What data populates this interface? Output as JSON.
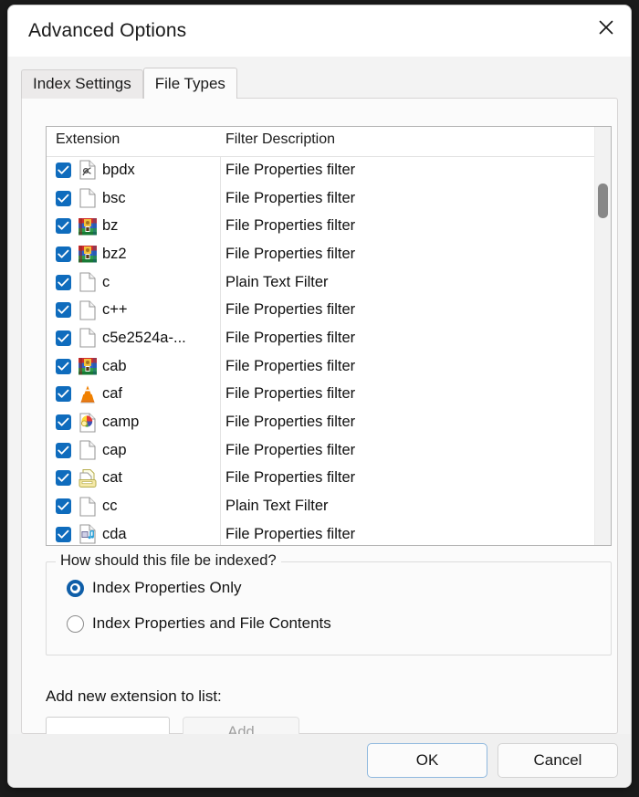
{
  "window": {
    "title": "Advanced Options",
    "close_icon": "close-icon"
  },
  "tabs": [
    {
      "label": "Index Settings",
      "active": false
    },
    {
      "label": "File Types",
      "active": true
    }
  ],
  "file_types_list": {
    "columns": {
      "extension": "Extension",
      "description": "Filter Description"
    },
    "rows": [
      {
        "checked": true,
        "icon": "pdf-file-icon",
        "ext": "bpdx",
        "desc": "File Properties filter"
      },
      {
        "checked": true,
        "icon": "blank-file-icon",
        "ext": "bsc",
        "desc": "File Properties filter"
      },
      {
        "checked": true,
        "icon": "archive-icon",
        "ext": "bz",
        "desc": "File Properties filter"
      },
      {
        "checked": true,
        "icon": "archive-icon",
        "ext": "bz2",
        "desc": "File Properties filter"
      },
      {
        "checked": true,
        "icon": "blank-file-icon",
        "ext": "c",
        "desc": "Plain Text Filter"
      },
      {
        "checked": true,
        "icon": "blank-file-icon",
        "ext": "c++",
        "desc": "File Properties filter"
      },
      {
        "checked": true,
        "icon": "blank-file-icon",
        "ext": "c5e2524a-...",
        "desc": "File Properties filter"
      },
      {
        "checked": true,
        "icon": "archive-icon",
        "ext": "cab",
        "desc": "File Properties filter"
      },
      {
        "checked": true,
        "icon": "vlc-cone-icon",
        "ext": "caf",
        "desc": "File Properties filter"
      },
      {
        "checked": true,
        "icon": "camtasia-icon",
        "ext": "camp",
        "desc": "File Properties filter"
      },
      {
        "checked": true,
        "icon": "blank-file-icon",
        "ext": "cap",
        "desc": "File Properties filter"
      },
      {
        "checked": true,
        "icon": "catalog-icon",
        "ext": "cat",
        "desc": "File Properties filter"
      },
      {
        "checked": true,
        "icon": "blank-file-icon",
        "ext": "cc",
        "desc": "Plain Text Filter"
      },
      {
        "checked": true,
        "icon": "media-file-icon",
        "ext": "cda",
        "desc": "File Properties filter"
      }
    ]
  },
  "index_group": {
    "legend": "How should this file be indexed?",
    "options": [
      {
        "label": "Index Properties Only",
        "selected": true
      },
      {
        "label": "Index Properties and File Contents",
        "selected": false
      }
    ]
  },
  "add_extension": {
    "label": "Add new extension to list:",
    "value": "",
    "placeholder": "",
    "button_label": "Add",
    "button_enabled": false
  },
  "footer": {
    "ok_label": "OK",
    "cancel_label": "Cancel"
  },
  "colors": {
    "accent": "#0f6cbd",
    "radio_accent": "#0f5ea8",
    "default_button_border": "#8fb8de",
    "scrollbar_thumb": "#878787"
  }
}
